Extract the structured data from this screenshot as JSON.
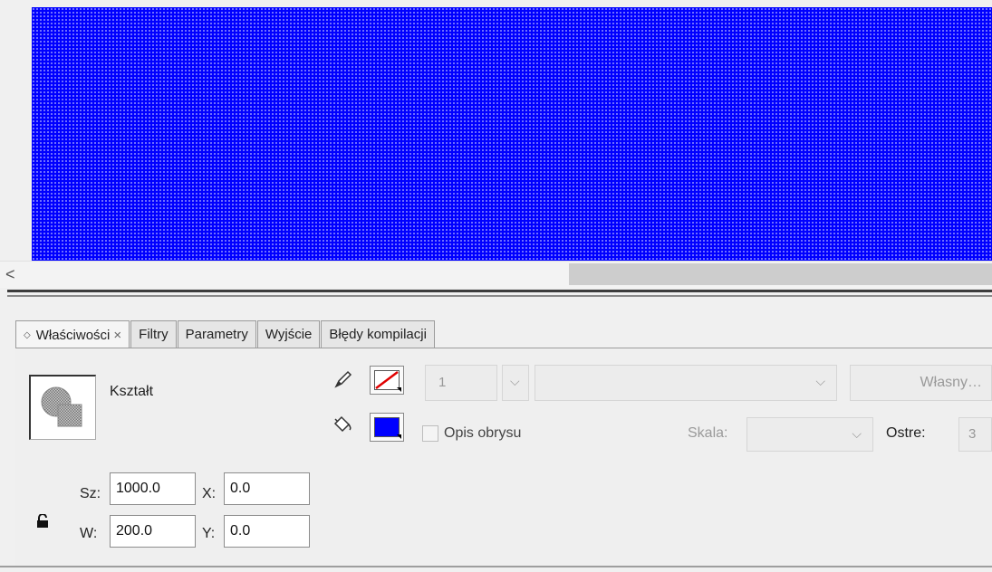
{
  "stage": {
    "fill_color": "#0000ff",
    "scroll_left_glyph": "<"
  },
  "tabs": [
    {
      "label": "Właściwości",
      "active": true,
      "close": "×",
      "diamond": "◇"
    },
    {
      "label": "Filtry"
    },
    {
      "label": "Parametry"
    },
    {
      "label": "Wyjście"
    },
    {
      "label": "Błędy kompilacji"
    }
  ],
  "shape": {
    "label": "Kształt"
  },
  "stroke": {
    "icon": "pencil-icon",
    "width_value": "1",
    "style_preset": "Własny…"
  },
  "fill": {
    "icon": "paint-bucket-icon",
    "color": "#0000ff",
    "hinting_label": "Opis obrysu",
    "scale_label": "Skala:",
    "miter_label": "Ostre:",
    "miter_value": "3"
  },
  "dimensions": {
    "width_label": "Sz:",
    "width_value": "1000.0",
    "height_label": "W:",
    "height_value": "200.0",
    "x_label": "X:",
    "x_value": "0.0",
    "y_label": "Y:",
    "y_value": "0.0",
    "lock_icon": "lock-icon"
  }
}
